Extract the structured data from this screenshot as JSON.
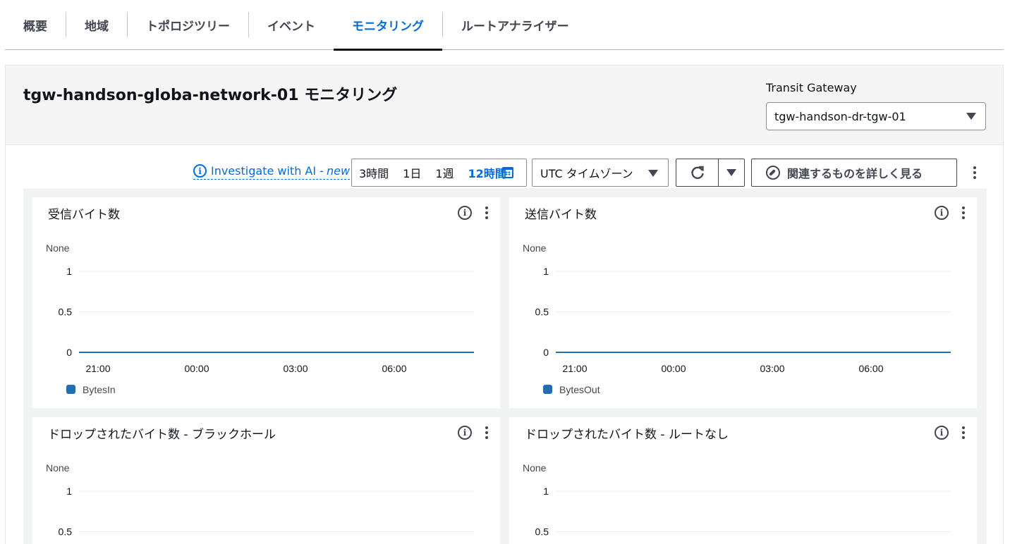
{
  "tabs": [
    {
      "label": "概要",
      "active": false
    },
    {
      "label": "地域",
      "active": false
    },
    {
      "label": "トポロジツリー",
      "active": false
    },
    {
      "label": "イベント",
      "active": false
    },
    {
      "label": "モニタリング",
      "active": true
    },
    {
      "label": "ルートアナライザー",
      "active": false
    }
  ],
  "header": {
    "title": "tgw-handson-globa-network-01 モニタリング",
    "tgw_label": "Transit Gateway",
    "tgw_value": "tgw-handson-dr-tgw-01"
  },
  "toolbar": {
    "ai_link_text": "Investigate with AI - ",
    "ai_link_new": "new",
    "ranges": [
      "3時間",
      "1日",
      "1週",
      "12時間"
    ],
    "selected_range": "12時間",
    "timezone": "UTC タイムゾーン",
    "explore_label": "関連するものを詳しく見る"
  },
  "colors": {
    "accent": "#006ce0",
    "series": "#1f6fb2"
  },
  "icons": [
    "info-icon",
    "calendar-icon",
    "refresh-icon",
    "caret-down-icon",
    "compass-icon",
    "more-vertical-icon"
  ],
  "chart_data": [
    {
      "type": "line",
      "title": "受信バイト数",
      "ylabel": "None",
      "ylim": [
        0,
        1
      ],
      "yticks": [
        "1",
        "0.5",
        "0"
      ],
      "xticks": [
        "21:00",
        "00:00",
        "03:00",
        "06:00"
      ],
      "series": [
        {
          "name": "BytesIn",
          "values": [
            0,
            0,
            0,
            0,
            0
          ]
        }
      ]
    },
    {
      "type": "line",
      "title": "送信バイト数",
      "ylabel": "None",
      "ylim": [
        0,
        1
      ],
      "yticks": [
        "1",
        "0.5",
        "0"
      ],
      "xticks": [
        "21:00",
        "00:00",
        "03:00",
        "06:00"
      ],
      "series": [
        {
          "name": "BytesOut",
          "values": [
            0,
            0,
            0,
            0,
            0
          ]
        }
      ]
    },
    {
      "type": "line",
      "title": "ドロップされたバイト数 - ブラックホール",
      "ylabel": "None",
      "ylim": [
        0,
        1
      ],
      "yticks": [
        "1",
        "0.5"
      ],
      "xticks": [],
      "series": []
    },
    {
      "type": "line",
      "title": "ドロップされたバイト数 - ルートなし",
      "ylabel": "None",
      "ylim": [
        0,
        1
      ],
      "yticks": [
        "1",
        "0.5"
      ],
      "xticks": [],
      "series": []
    }
  ]
}
